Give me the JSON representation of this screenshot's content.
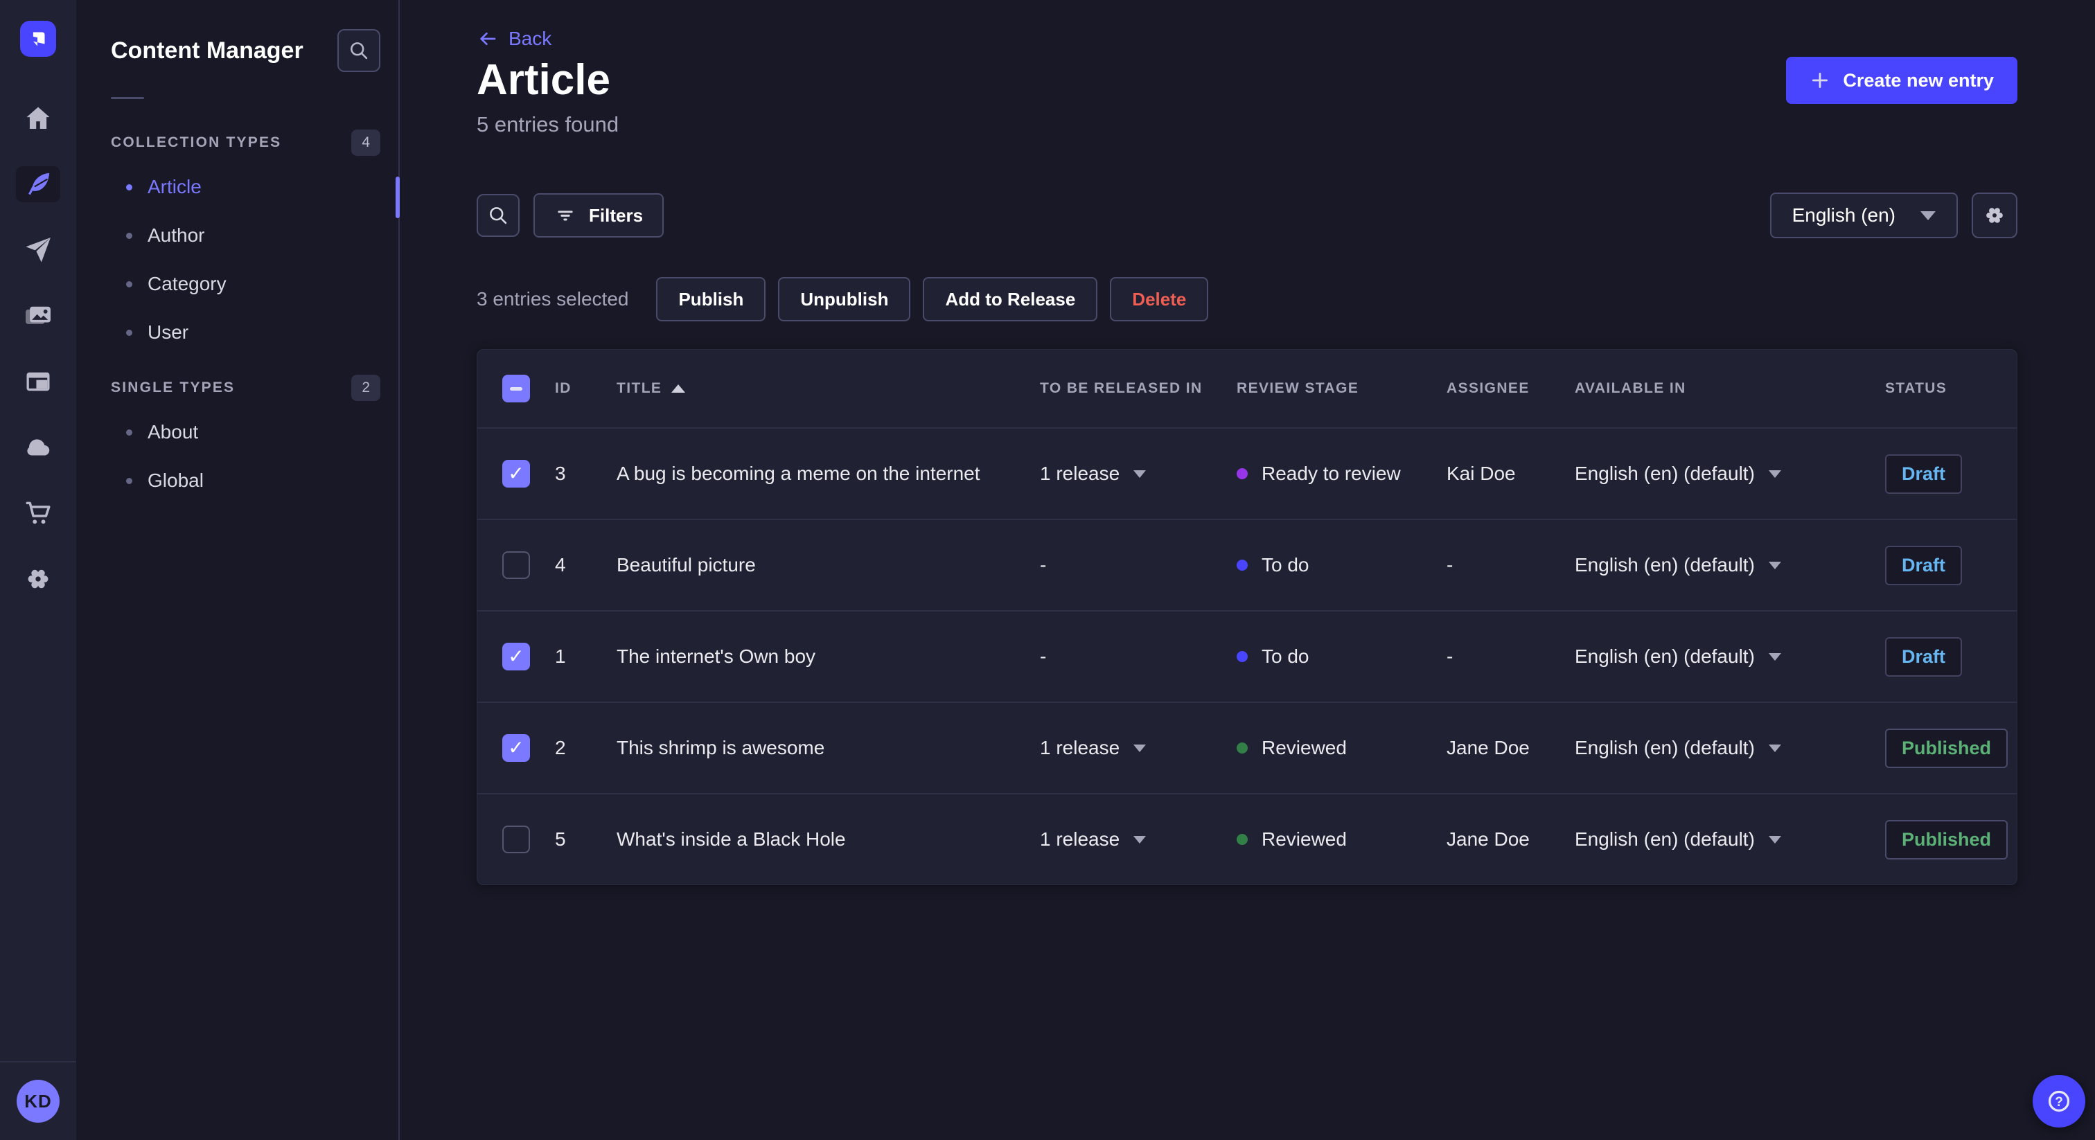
{
  "rail": {
    "icons": [
      "home",
      "content-manager",
      "releases",
      "media-library",
      "content-builder",
      "cloud",
      "marketplace",
      "settings"
    ],
    "active_icon": "content-manager",
    "avatar_initials": "KD"
  },
  "subnav": {
    "title": "Content Manager",
    "search_icon": "search-icon",
    "sections": [
      {
        "label": "COLLECTION TYPES",
        "count": "4",
        "items": [
          {
            "label": "Article",
            "active": true
          },
          {
            "label": "Author",
            "active": false
          },
          {
            "label": "Category",
            "active": false
          },
          {
            "label": "User",
            "active": false
          }
        ]
      },
      {
        "label": "SINGLE TYPES",
        "count": "2",
        "items": [
          {
            "label": "About",
            "active": false
          },
          {
            "label": "Global",
            "active": false
          }
        ]
      }
    ]
  },
  "header": {
    "back_label": "Back",
    "title": "Article",
    "subtitle": "5 entries found",
    "create_button_label": "Create new entry"
  },
  "toolbar": {
    "filters_label": "Filters",
    "locale_value": "English (en)"
  },
  "selection": {
    "text": "3 entries selected",
    "actions": [
      "Publish",
      "Unpublish",
      "Add to Release",
      "Delete"
    ]
  },
  "table": {
    "headers": {
      "id": "ID",
      "title": "TITLE",
      "release": "TO BE RELEASED IN",
      "review": "REVIEW STAGE",
      "assignee": "ASSIGNEE",
      "available": "AVAILABLE IN",
      "status": "STATUS"
    },
    "sort": {
      "column": "TITLE",
      "direction": "asc"
    },
    "header_checkbox_state": "indeterminate",
    "rows": [
      {
        "checked": true,
        "id": "3",
        "title": "A bug is becoming a meme on the internet",
        "release": "1 release",
        "stage": "Ready to review",
        "stage_color": "#9736e8",
        "assignee": "Kai Doe",
        "available": "English (en) (default)",
        "status": "Draft"
      },
      {
        "checked": false,
        "id": "4",
        "title": "Beautiful picture",
        "release": "-",
        "stage": "To do",
        "stage_color": "#4945ff",
        "assignee": "-",
        "available": "English (en) (default)",
        "status": "Draft"
      },
      {
        "checked": true,
        "id": "1",
        "title": "The internet's Own boy",
        "release": "-",
        "stage": "To do",
        "stage_color": "#4945ff",
        "assignee": "-",
        "available": "English (en) (default)",
        "status": "Draft"
      },
      {
        "checked": true,
        "id": "2",
        "title": "This shrimp is awesome",
        "release": "1 release",
        "stage": "Reviewed",
        "stage_color": "#328048",
        "assignee": "Jane Doe",
        "available": "English (en) (default)",
        "status": "Published"
      },
      {
        "checked": false,
        "id": "5",
        "title": "What's inside a Black Hole",
        "release": "1 release",
        "stage": "Reviewed",
        "stage_color": "#328048",
        "assignee": "Jane Doe",
        "available": "English (en) (default)",
        "status": "Published"
      }
    ]
  },
  "colors": {
    "accent": "#4945ff",
    "link": "#7b79ff",
    "draft": "#66b7f1",
    "published": "#5cb176",
    "danger": "#ee5e52",
    "stage_ready_to_review": "#9736e8",
    "stage_to_do": "#4945ff",
    "stage_reviewed": "#328048",
    "page_bg": "#181826",
    "card_bg": "#212134"
  }
}
